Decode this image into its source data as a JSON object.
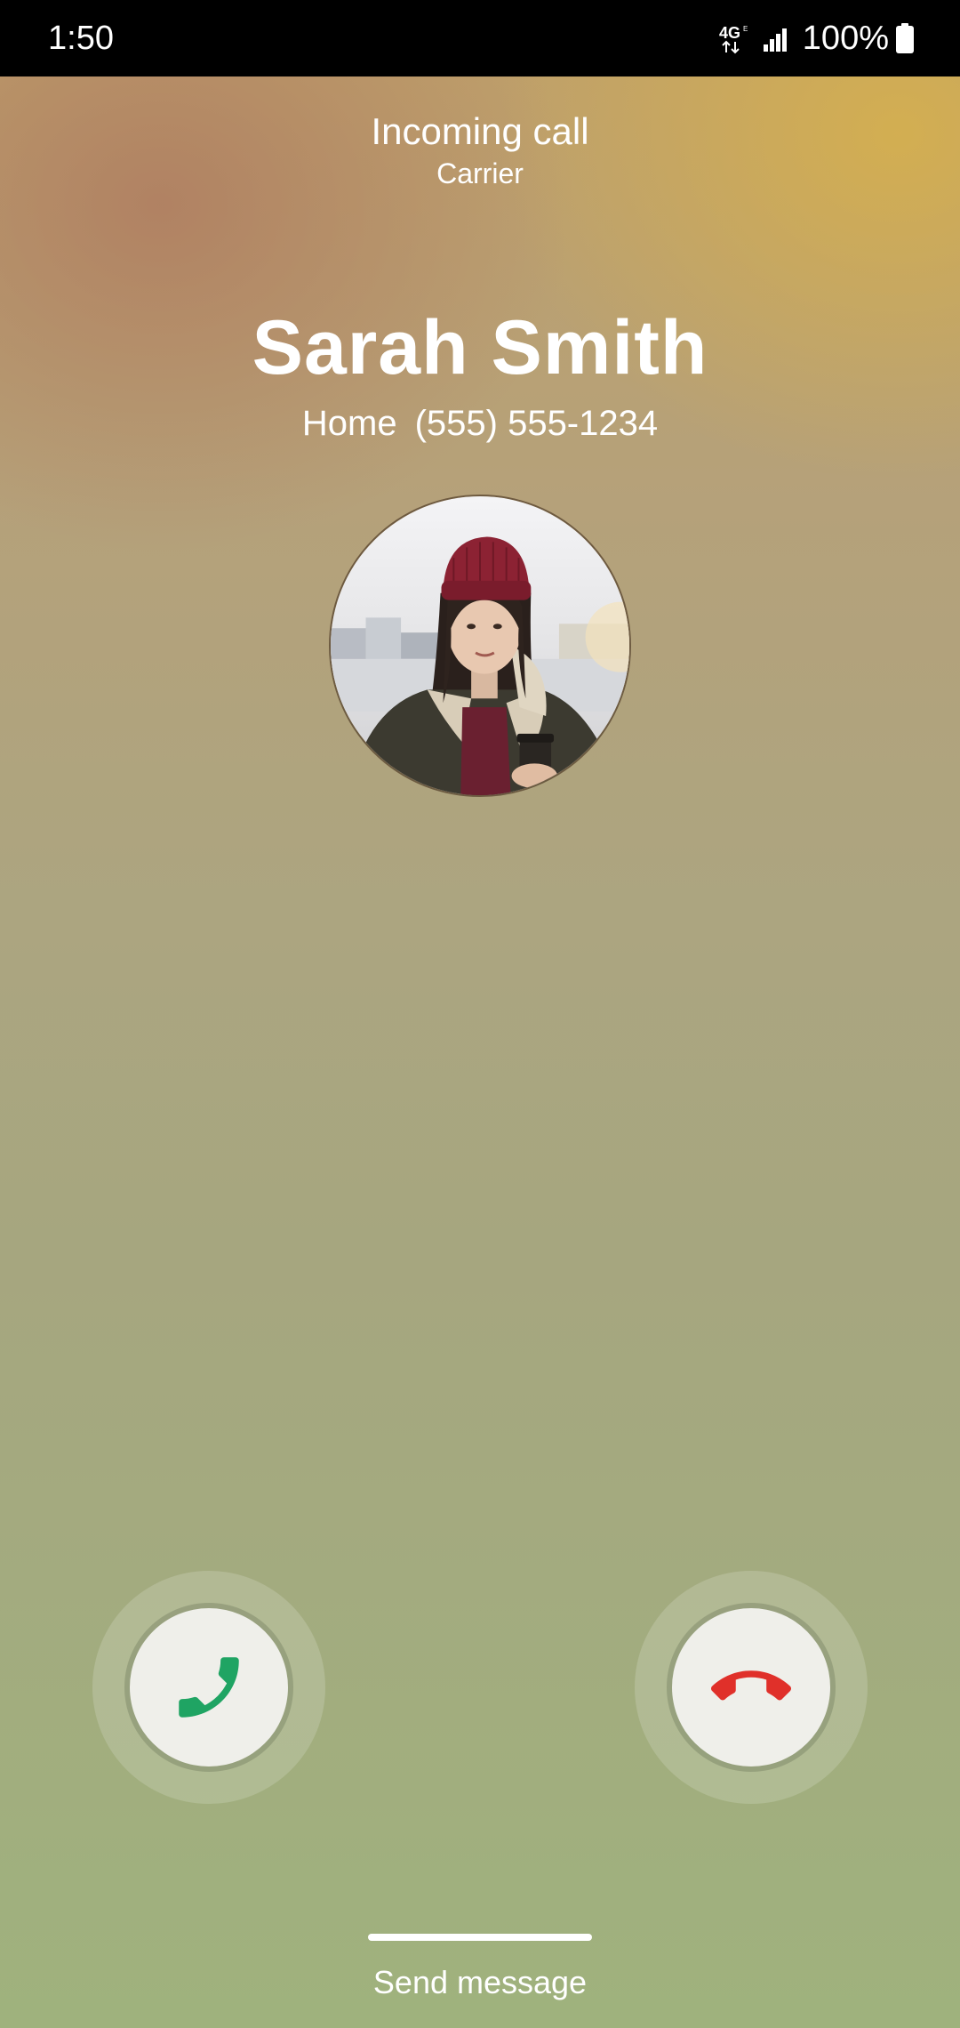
{
  "status_bar": {
    "time": "1:50",
    "network_icon": "4g-lte-icon",
    "signal_icon": "cell-signal-icon",
    "battery_text": "100%",
    "battery_icon": "battery-full-icon"
  },
  "call": {
    "status": "Incoming call",
    "carrier": "Carrier",
    "caller_name": "Sarah Smith",
    "number_type": "Home",
    "number": "(555) 555-1234"
  },
  "actions": {
    "answer_icon": "phone-answer-icon",
    "decline_icon": "phone-hangup-icon",
    "send_message_label": "Send message"
  },
  "colors": {
    "answer": "#1fa463",
    "decline": "#e0302a",
    "button_face": "#efefea"
  }
}
